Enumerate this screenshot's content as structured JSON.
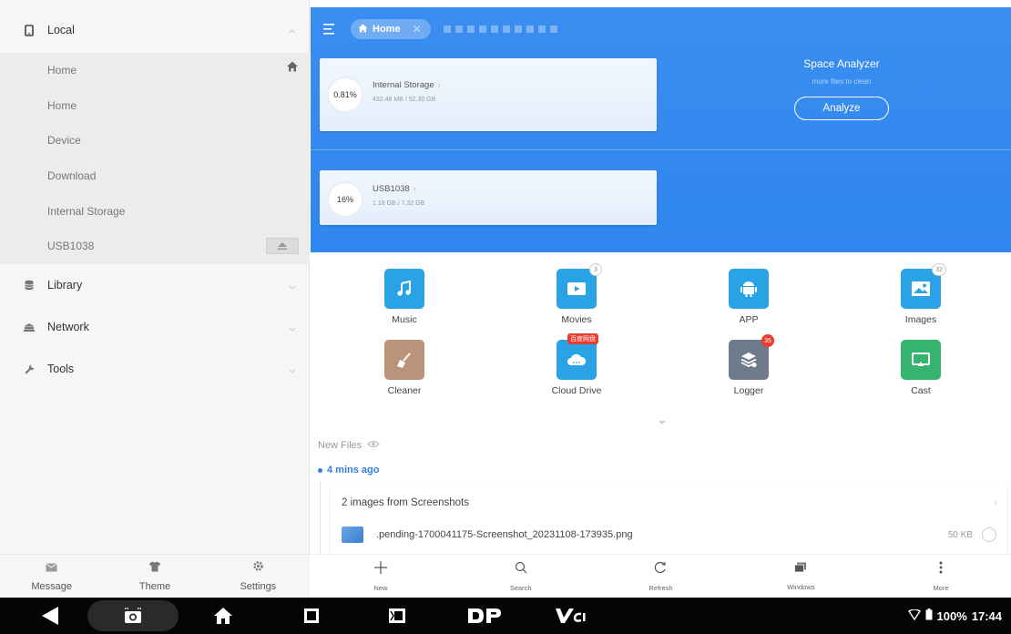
{
  "sidebar": {
    "local": {
      "label": "Local"
    },
    "local_items": [
      {
        "label": "Home"
      },
      {
        "label": "Home"
      },
      {
        "label": "Device"
      },
      {
        "label": "Download"
      },
      {
        "label": "Internal Storage"
      },
      {
        "label": "USB1038"
      }
    ],
    "library": {
      "label": "Library"
    },
    "network": {
      "label": "Network"
    },
    "tools": {
      "label": "Tools"
    },
    "bottom": {
      "message": "Message",
      "theme": "Theme",
      "settings": "Settings"
    }
  },
  "topbar": {
    "home_tab": "Home",
    "close_glyph": "✕"
  },
  "storage": [
    {
      "percent": "0.81%",
      "name": "Internal Storage",
      "usage": "432.48 MB / 52.30 GB"
    },
    {
      "percent": "16%",
      "name": "USB1038",
      "usage": "1.18 GB / 7.32 GB"
    }
  ],
  "analyzer": {
    "title": "Space Analyzer",
    "subtitle": "more files to clean",
    "button": "Analyze"
  },
  "categories": [
    {
      "label": "Music",
      "color": "#29a3e6",
      "icon": "music-icon",
      "badge": ""
    },
    {
      "label": "Movies",
      "color": "#29a3e6",
      "icon": "movie-icon",
      "badge": "3"
    },
    {
      "label": "APP",
      "color": "#29a3e6",
      "icon": "android-icon",
      "badge": ""
    },
    {
      "label": "Images",
      "color": "#29a3e6",
      "icon": "image-icon",
      "badge": "32"
    },
    {
      "label": "Cleaner",
      "color": "#b9937a",
      "icon": "broom-icon",
      "badge": ""
    },
    {
      "label": "Cloud Drive",
      "color": "#29a3e6",
      "icon": "cloud-icon",
      "badge": "百度网盘"
    },
    {
      "label": "Logger",
      "color": "#6f7a8c",
      "icon": "logger-icon",
      "badge": "35"
    },
    {
      "label": "Cast",
      "color": "#35b46f",
      "icon": "cast-icon",
      "badge": ""
    }
  ],
  "new_files": {
    "label": "New Files",
    "time": "4 mins ago",
    "group_title": "2 images from Screenshots",
    "file": {
      "name": ".pending-1700041175-Screenshot_20231108-173935.png",
      "size": "50 KB"
    }
  },
  "toolbar": {
    "new": "New",
    "search": "Search",
    "refresh": "Refresh",
    "windows": "Windows",
    "more": "More"
  },
  "status": {
    "battery": "100%",
    "time": "17:44"
  },
  "colors": {
    "header_blue": "#3a8ef0",
    "accent": "#2f7fe0"
  }
}
